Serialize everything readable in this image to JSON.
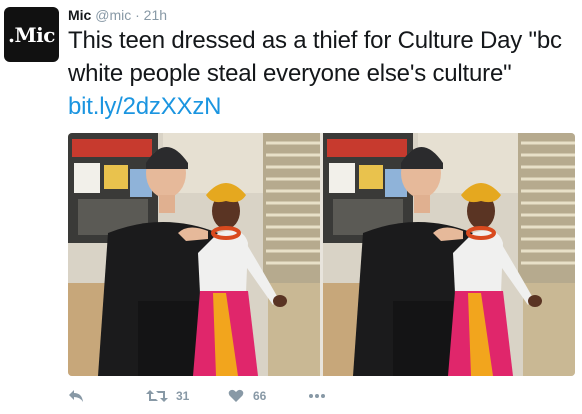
{
  "tweet": {
    "author_name": "Mic",
    "handle": "@mic",
    "separator": " · ",
    "time": "21h",
    "avatar_text": ".Mic",
    "text_main": "This teen dressed as a thief for Culture Day \"bc white people steal everyone else's culture\" ",
    "link": "bit.ly/2dzXXzN"
  },
  "actions": {
    "retweet_count": "31",
    "like_count": "66"
  },
  "colors": {
    "link": "#1b95e0",
    "muted": "#8899a6",
    "text": "#14171a"
  }
}
